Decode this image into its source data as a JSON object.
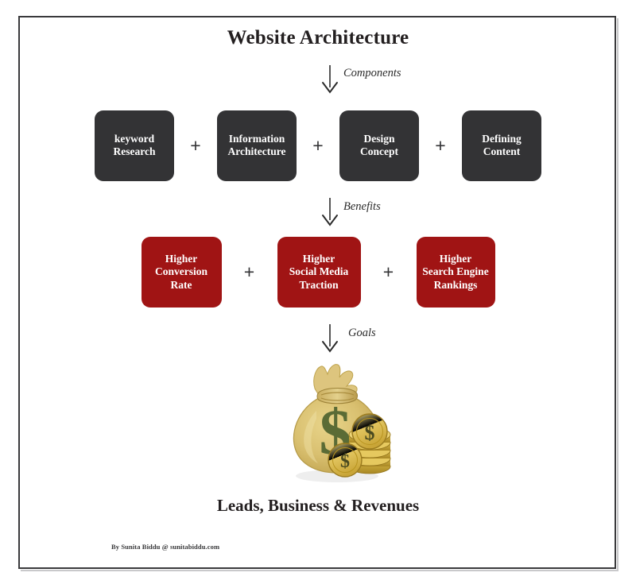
{
  "diagram": {
    "title": "Website Architecture",
    "caption": "Leads, Business & Revenues",
    "credit": "By Sunita Biddu @ sunitabiddu.com",
    "colors": {
      "dark_box": "#333335",
      "red_box": "#a01414",
      "frame": "#3a3a3c",
      "text_dark": "#231f20",
      "box_text": "#ffffff"
    },
    "arrows": [
      {
        "label": "Components"
      },
      {
        "label": "Benefits"
      },
      {
        "label": "Goals"
      }
    ],
    "operators": {
      "plus": "+"
    },
    "rows": [
      {
        "name": "components",
        "style": "dark",
        "boxes": [
          {
            "line1": "keyword",
            "line2": "Research"
          },
          {
            "line1": "Information",
            "line2": "Architecture"
          },
          {
            "line1": "Design",
            "line2": "Concept"
          },
          {
            "line1": "Defining",
            "line2": "Content"
          }
        ]
      },
      {
        "name": "benefits",
        "style": "red",
        "boxes": [
          {
            "line1": "Higher",
            "line2": "Conversion",
            "line3": "Rate"
          },
          {
            "line1": "Higher",
            "line2": "Social Media",
            "line3": "Traction"
          },
          {
            "line1": "Higher",
            "line2": "Search Engine",
            "line3": "Rankings"
          }
        ]
      }
    ],
    "goal_image": {
      "name": "money-bag-with-coins",
      "symbol": "$"
    }
  }
}
